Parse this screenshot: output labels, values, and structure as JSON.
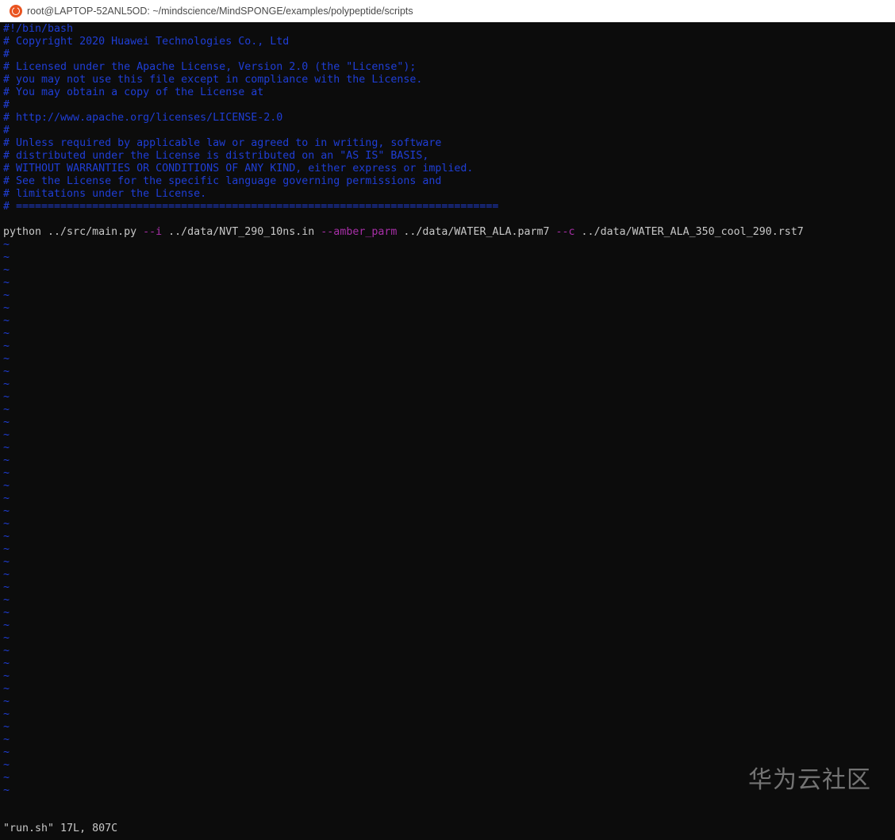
{
  "window": {
    "title": "root@LAPTOP-52ANL5OD: ~/mindscience/MindSPONGE/examples/polypeptide/scripts",
    "icon": "ubuntu-icon"
  },
  "editor": {
    "comment_lines": [
      "#!/bin/bash",
      "# Copyright 2020 Huawei Technologies Co., Ltd",
      "#",
      "# Licensed under the Apache License, Version 2.0 (the \"License\");",
      "# you may not use this file except in compliance with the License.",
      "# You may obtain a copy of the License at",
      "#",
      "# http://www.apache.org/licenses/LICENSE-2.0",
      "#",
      "# Unless required by applicable law or agreed to in writing, software",
      "# distributed under the License is distributed on an \"AS IS\" BASIS,",
      "# WITHOUT WARRANTIES OR CONDITIONS OF ANY KIND, either express or implied.",
      "# See the License for the specific language governing permissions and",
      "# limitations under the License.",
      "# ============================================================================"
    ],
    "blank_line": "",
    "command_line": {
      "cmd": "python ../src/main.py ",
      "flag_i": "--i",
      "arg_i": " ../data/NVT_290_10ns.in ",
      "flag_amber": "--amber_parm",
      "arg_amber": " ../data/WATER_ALA.parm7 ",
      "flag_c": "--c",
      "arg_c": " ../data/WATER_ALA_350_cool_290.rst7"
    },
    "empty_marker": "~",
    "empty_marker_count": 44
  },
  "status": {
    "file_info": "\"run.sh\" 17L, 807C"
  },
  "watermark": {
    "text": "华为云社区"
  },
  "colors": {
    "comment": "#1f3ed6",
    "flag": "#a82fa8",
    "text": "#c8c8c8",
    "background": "#0c0c0c"
  }
}
